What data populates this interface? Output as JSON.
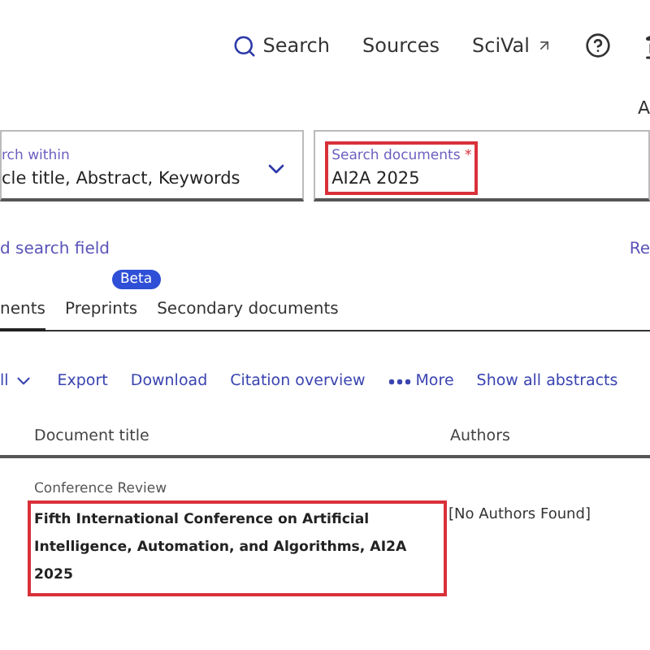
{
  "nav": {
    "items": [
      {
        "label": "Search",
        "kind": "search"
      },
      {
        "label": "Sources",
        "kind": "plain"
      },
      {
        "label": "SciVal",
        "kind": "external"
      }
    ]
  },
  "corner_text": "A",
  "search_within": {
    "label": "rch within",
    "value": "cle title, Abstract, Keywords"
  },
  "search_field": {
    "label": "Search documents",
    "required_mark": "*",
    "value": "AI2A 2025",
    "highlighted": true
  },
  "add_field_link": "d search field",
  "right_link": "Re",
  "tabs": [
    {
      "label": "nents",
      "selected": true
    },
    {
      "label": "Preprints",
      "selected": false,
      "badge": "Beta"
    },
    {
      "label": "Secondary documents",
      "selected": false
    }
  ],
  "actions": [
    {
      "label": "ll",
      "kind": "dropdown"
    },
    {
      "label": "Export",
      "kind": "plain"
    },
    {
      "label": "Download",
      "kind": "plain"
    },
    {
      "label": "Citation overview",
      "kind": "plain"
    },
    {
      "label": "More",
      "kind": "more"
    },
    {
      "label": "Show all abstracts",
      "kind": "plain"
    }
  ],
  "table": {
    "columns": [
      "Document title",
      "Authors"
    ],
    "rows": [
      {
        "type": "Conference Review",
        "title": "Fifth International Conference on Artificial Intelligence, Automation, and Algorithms, AI2A 2025",
        "authors": "[No Authors Found]",
        "highlighted": true
      }
    ]
  }
}
